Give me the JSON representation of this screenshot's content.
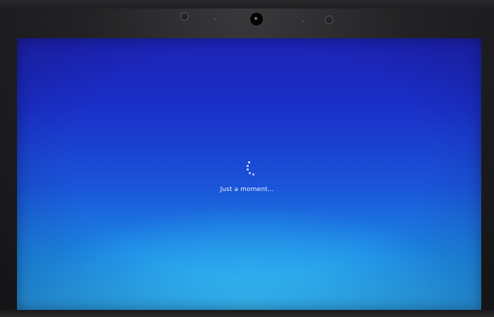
{
  "screen": {
    "status_message": "Just a moment...",
    "background_color_top": "#1d22b4",
    "background_color_bottom": "#2aa9ee",
    "text_color": "#eef2ff"
  },
  "device": {
    "bezel_color": "#1b1b1d",
    "webcam_icon": "webcam-icon"
  }
}
